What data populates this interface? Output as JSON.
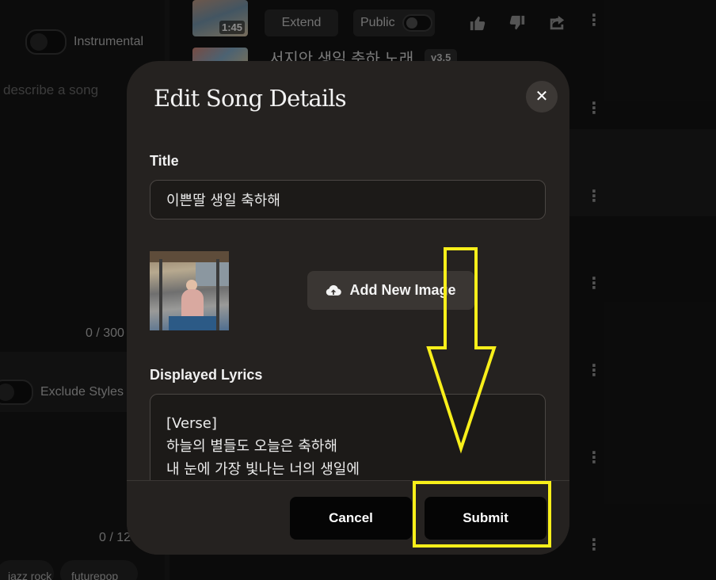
{
  "background": {
    "left_panel": {
      "instrumental_label": "Instrumental",
      "prompt_placeholder": "describe a song",
      "char_count_1": "0 / 300",
      "exclude_styles_label": "Exclude Styles",
      "char_count_2": "0 / 12",
      "chip_1": "jazz rock",
      "chip_2": "futurepop"
    },
    "song_list": {
      "song_1_duration": "1:45",
      "extend_label": "Extend",
      "public_label": "Public",
      "song_2_title": "서지안 생일 축하 노래",
      "song_2_version": "v3.5"
    }
  },
  "modal": {
    "title": "Edit Song Details",
    "close_icon": "close-icon",
    "title_label": "Title",
    "title_value": "이쁜딸 생일 축하해",
    "add_image_label": "Add New Image",
    "add_image_icon": "cloud-upload-icon",
    "lyrics_label": "Displayed Lyrics",
    "lyrics_lines": [
      "[Verse]",
      "하늘의 별들도 오늘은 축하해",
      "내 눈에 가장 빛나는 너의 생일에"
    ],
    "cancel_label": "Cancel",
    "submit_label": "Submit"
  },
  "annotation": {
    "color": "#f8ef1a",
    "arrow_icon": "down-arrow-icon"
  }
}
